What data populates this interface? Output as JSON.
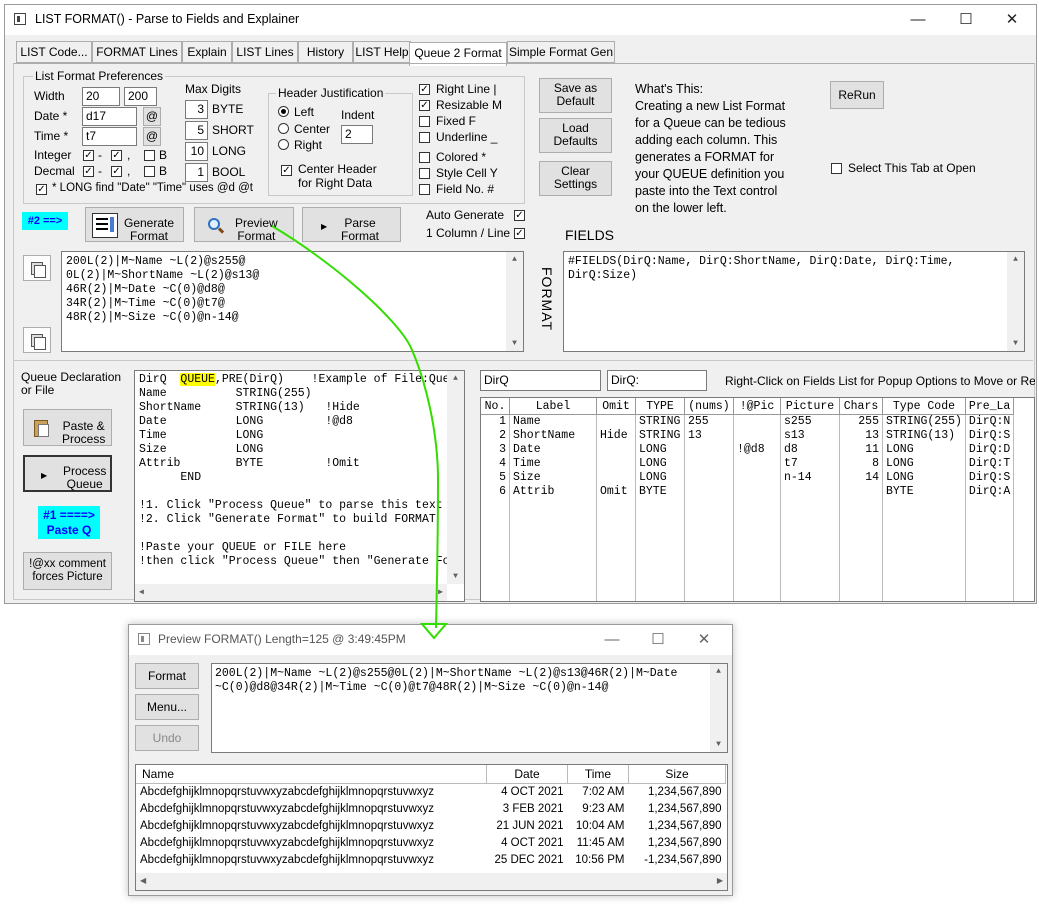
{
  "main_window": {
    "title": "LIST FORMAT() - Parse to Fields and Explainer",
    "tabs": [
      "LIST Code...",
      "FORMAT Lines",
      "Explain",
      "LIST Lines",
      "History",
      "LIST Help",
      "Queue 2 Format",
      "Simple Format Gen"
    ],
    "prefs": {
      "group_label": "List Format Preferences",
      "width_label": "Width",
      "width_min": "20",
      "width_dash": "-",
      "width_max": "200",
      "date_label": "Date *",
      "date_value": "d17",
      "at": "@",
      "time_label": "Time *",
      "time_value": "t7",
      "integer_label": "Integer",
      "decimal_label": "Decmal",
      "minus": "-",
      "comma": ",",
      "b": "B",
      "long_note": "* LONG find \"Date\" \"Time\" uses @d @t"
    },
    "max_digits": {
      "label": "Max Digits",
      "rows": [
        {
          "value": "3",
          "label": "BYTE"
        },
        {
          "value": "5",
          "label": "SHORT"
        },
        {
          "value": "10",
          "label": "LONG"
        },
        {
          "value": "1",
          "label": "BOOL"
        }
      ]
    },
    "header_just": {
      "label": "Header Justification",
      "left": "Left",
      "center": "Center",
      "right": "Right",
      "indent_label": "Indent",
      "indent_value": "2",
      "center_header": "Center Header",
      "center_header2": "for Right Data"
    },
    "flags": [
      "Right Line |",
      "Resizable M",
      "Fixed F",
      "Underline _",
      "Colored *",
      "Style Cell Y",
      "Field No. #"
    ],
    "buttons": {
      "save_default": [
        "Save as",
        "Default"
      ],
      "load_defaults": [
        "Load",
        "Defaults"
      ],
      "clear_settings": [
        "Clear",
        "Settings"
      ],
      "rerun": "ReRun",
      "generate": [
        "Generate",
        "Format"
      ],
      "preview": [
        "Preview",
        "Format"
      ],
      "parse": [
        "Parse",
        "Format"
      ],
      "paste_process": [
        "Paste &",
        "Process"
      ],
      "process_queue": [
        "Process",
        "Queue"
      ],
      "comment_picture": [
        "!@xx comment",
        "forces Picture"
      ]
    },
    "whats_this": [
      "What's This:",
      "Creating a new List Format",
      "for a Queue can be tedious",
      "adding each column. This",
      "generates a FORMAT for",
      "your QUEUE definition you",
      "paste into the Text control",
      "on the lower left."
    ],
    "select_tab": "Select This Tab at Open",
    "step2": "#2 ==>",
    "auto_generate": "Auto Generate",
    "one_column": "1 Column / Line",
    "fields_label": "FIELDS",
    "format_vertical": "FORMAT",
    "format_lines": [
      "200L(2)|M~Name ~L(2)@s255@",
      "0L(2)|M~ShortName ~L(2)@s13@",
      "46R(2)|M~Date ~C(0)@d8@",
      "34R(2)|M~Time ~C(0)@t7@",
      "48R(2)|M~Size ~C(0)@n-14@"
    ],
    "fields_lines": [
      "#FIELDS(DirQ:Name, DirQ:ShortName, DirQ:Date, DirQ:Time,",
      "DirQ:Size)"
    ],
    "queue_decl_label": [
      "Queue Declaration",
      "or File"
    ],
    "step1": [
      "#1 ====>",
      "Paste Q"
    ],
    "queue_text": {
      "first_pre": "DirQ  ",
      "first_kw": "QUEUE",
      "first_post": ",PRE(DirQ)    !Example of File:Que",
      "lines": [
        "Name          STRING(255)",
        "ShortName     STRING(13)   !Hide",
        "Date          LONG         !@d8",
        "Time          LONG",
        "Size          LONG",
        "Attrib        BYTE         !Omit",
        "      END",
        "",
        "!1. Click \"Process Queue\" to parse this text",
        "!2. Click \"Generate Format\" to build FORMAT",
        "",
        "!Paste your QUEUE or FILE here",
        "!then click \"Process Queue\" then \"Generate Fo"
      ]
    },
    "qname": "DirQ",
    "prefix": "DirQ:",
    "hint": "Right-Click on Fields List for Popup Options to Move or Remove",
    "fields_table": {
      "columns": [
        "No.",
        "Label",
        "Omit",
        "TYPE",
        "(nums)",
        "!@Pic",
        "Picture",
        "Chars",
        "Type Code",
        "Pre_La"
      ],
      "rows": [
        [
          "1",
          "Name",
          "",
          "STRING",
          "255",
          "",
          "s255",
          "255",
          "STRING(255)",
          "DirQ:N"
        ],
        [
          "2",
          "ShortName",
          "Hide",
          "STRING",
          "13",
          "",
          "s13",
          "13",
          "STRING(13)",
          "DirQ:S"
        ],
        [
          "3",
          "Date",
          "",
          "LONG",
          "",
          "!@d8",
          "d8",
          "11",
          "LONG",
          "DirQ:D"
        ],
        [
          "4",
          "Time",
          "",
          "LONG",
          "",
          "",
          "t7",
          "8",
          "LONG",
          "DirQ:T"
        ],
        [
          "5",
          "Size",
          "",
          "LONG",
          "",
          "",
          "n-14",
          "14",
          "LONG",
          "DirQ:S"
        ],
        [
          "6",
          "Attrib",
          "Omit",
          "BYTE",
          "",
          "",
          "",
          "",
          "BYTE",
          "DirQ:A"
        ]
      ]
    }
  },
  "preview_window": {
    "title": "Preview FORMAT() Length=125 @  3:49:45PM",
    "buttons": {
      "format": "Format",
      "menu": "Menu...",
      "undo": "Undo"
    },
    "format_text": [
      "200L(2)|M~Name ~L(2)@s255@0L(2)|M~ShortName ~L(2)@s13@46R(2)|M~Date",
      "~C(0)@d8@34R(2)|M~Time ~C(0)@t7@48R(2)|M~Size ~C(0)@n-14@"
    ],
    "columns": [
      "Name",
      "Date",
      "Time",
      "Size"
    ],
    "rows": [
      [
        "Abcdefghijklmnopqrstuvwxyzabcdefghijklmnopqrstuvwxyz",
        "4 OCT 2021",
        "7:02 AM",
        "1,234,567,890"
      ],
      [
        "Abcdefghijklmnopqrstuvwxyzabcdefghijklmnopqrstuvwxyz",
        "3 FEB 2021",
        "9:23 AM",
        "1,234,567,890"
      ],
      [
        "Abcdefghijklmnopqrstuvwxyzabcdefghijklmnopqrstuvwxyz",
        "21 JUN 2021",
        "10:04 AM",
        "1,234,567,890"
      ],
      [
        "Abcdefghijklmnopqrstuvwxyzabcdefghijklmnopqrstuvwxyz",
        "4 OCT 2021",
        "11:45 AM",
        "1,234,567,890"
      ],
      [
        "Abcdefghijklmnopqrstuvwxyzabcdefghijklmnopqrstuvwxyz",
        "25 DEC 2021",
        "10:56 PM",
        "-1,234,567,890"
      ]
    ]
  },
  "colors": {
    "highlight": "#00ffff",
    "queue_keyword": "#ffff00",
    "arrow": "#33dd00"
  }
}
